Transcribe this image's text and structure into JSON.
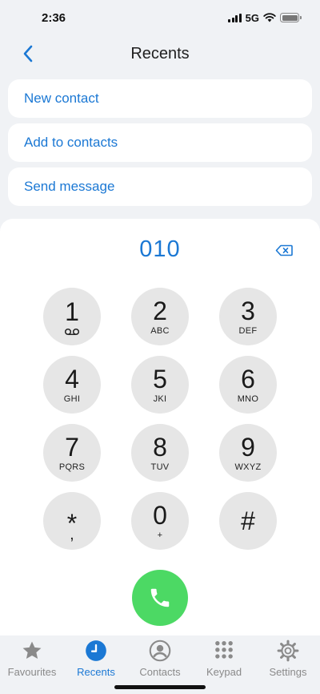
{
  "status": {
    "time": "2:36",
    "network": "5G"
  },
  "header": {
    "title": "Recents"
  },
  "options": [
    {
      "label": "New contact"
    },
    {
      "label": "Add to contacts"
    },
    {
      "label": "Send message"
    }
  ],
  "dialer": {
    "number": "010",
    "keys": [
      {
        "digit": "1",
        "letters": ""
      },
      {
        "digit": "2",
        "letters": "ABC"
      },
      {
        "digit": "3",
        "letters": "DEF"
      },
      {
        "digit": "4",
        "letters": "GHI"
      },
      {
        "digit": "5",
        "letters": "JKI"
      },
      {
        "digit": "6",
        "letters": "MNO"
      },
      {
        "digit": "7",
        "letters": "PQRS"
      },
      {
        "digit": "8",
        "letters": "TUV"
      },
      {
        "digit": "9",
        "letters": "WXYZ"
      },
      {
        "digit": "*",
        "letters": ","
      },
      {
        "digit": "0",
        "letters": "+"
      },
      {
        "digit": "#",
        "letters": ""
      }
    ]
  },
  "tabs": [
    {
      "label": "Favourites",
      "icon": "star-icon",
      "active": false
    },
    {
      "label": "Recents",
      "icon": "clock-icon",
      "active": true
    },
    {
      "label": "Contacts",
      "icon": "person-icon",
      "active": false
    },
    {
      "label": "Keypad",
      "icon": "keypad-icon",
      "active": false
    },
    {
      "label": "Settings",
      "icon": "gear-icon",
      "active": false
    }
  ],
  "colors": {
    "accent": "#1b78d4",
    "call": "#4cd964",
    "key": "#e6e6e6",
    "background": "#f0f2f5"
  }
}
